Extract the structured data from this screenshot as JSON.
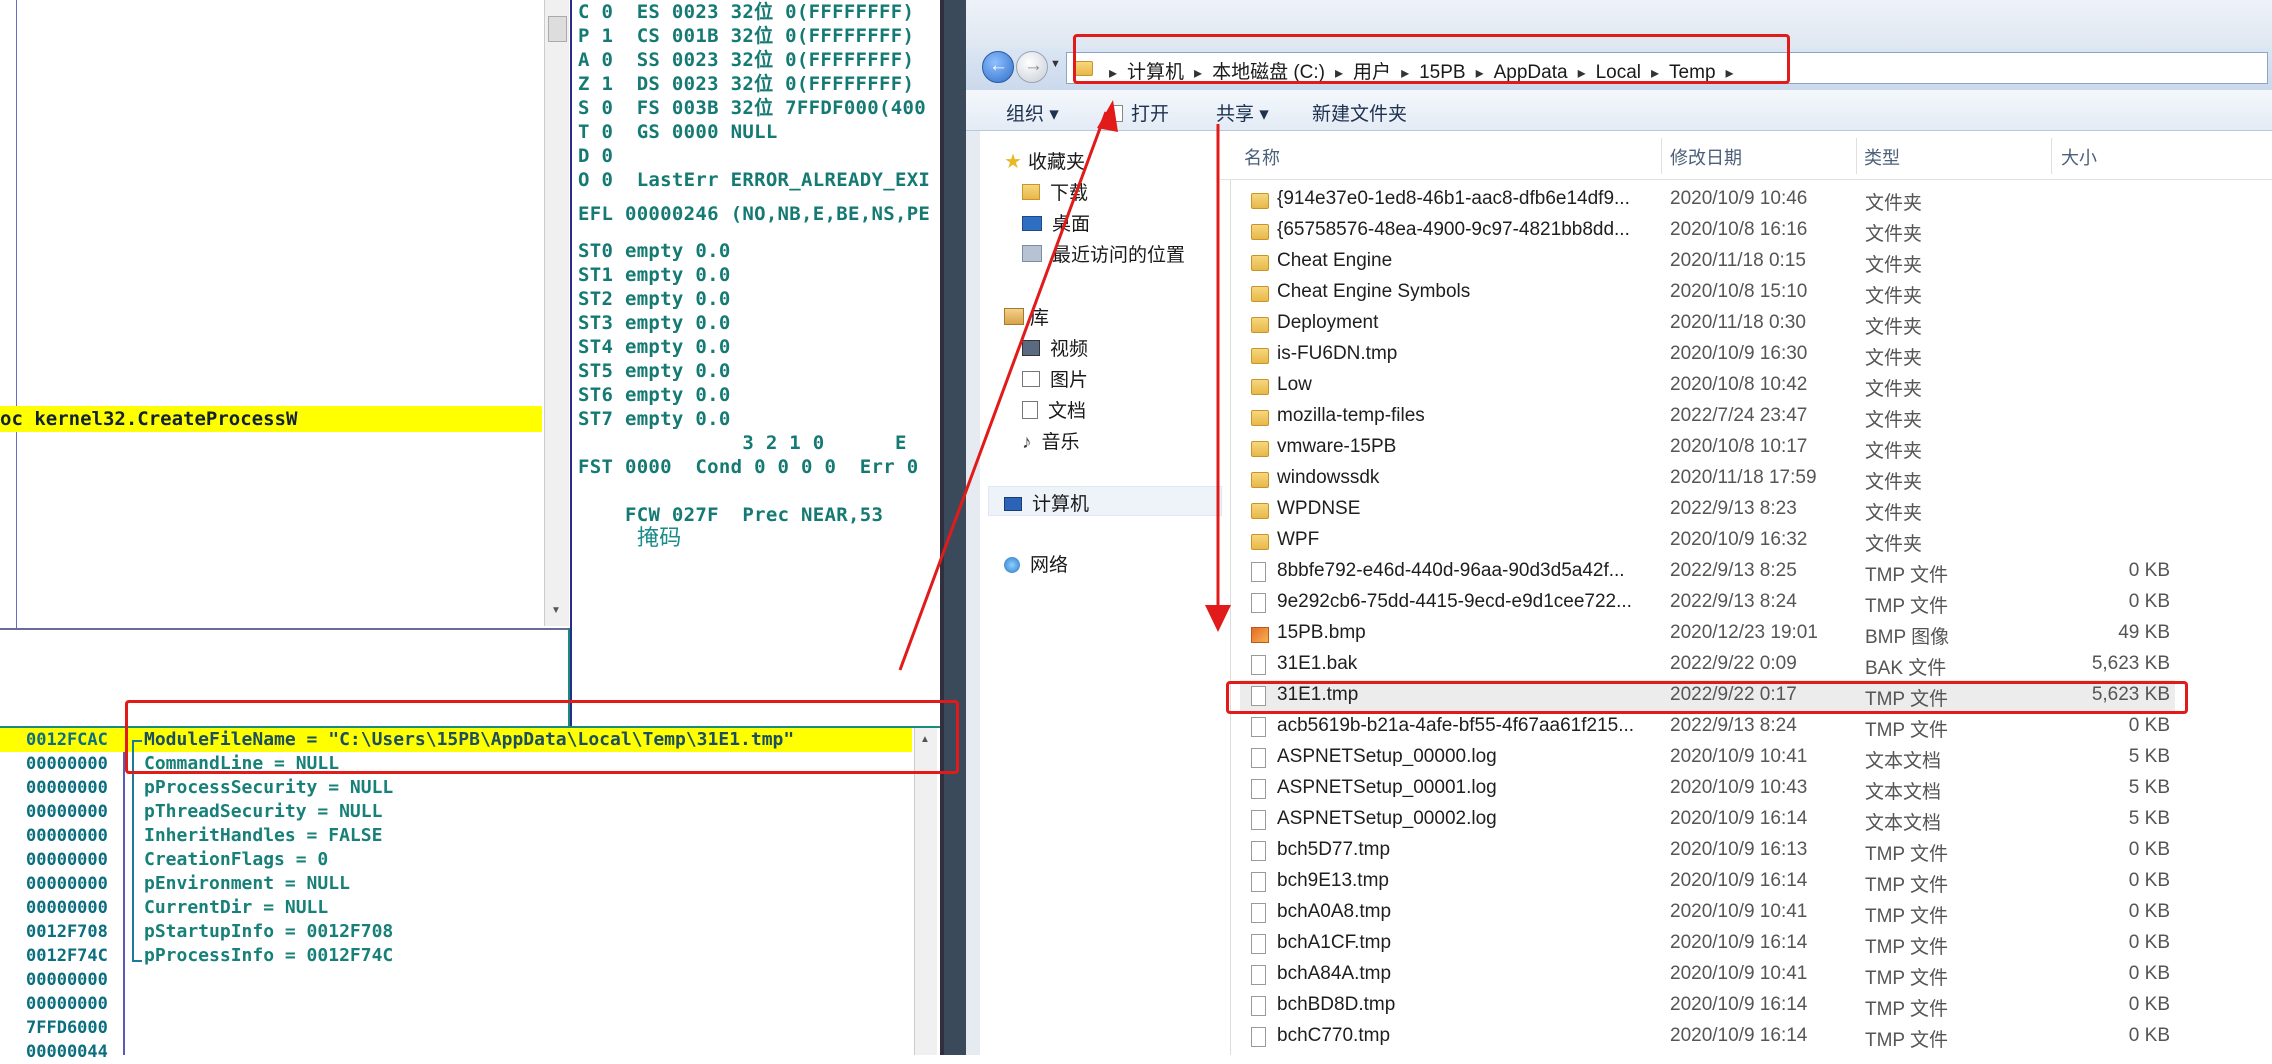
{
  "debugger": {
    "registers": [
      {
        "text": "C 0  ES 0023 32位 0(FFFFFFFF)"
      },
      {
        "text": "P 1  CS 001B 32位 0(FFFFFFFF)"
      },
      {
        "text": "A 0  SS 0023 32位 0(FFFFFFFF)"
      },
      {
        "text": "Z 1  DS 0023 32位 0(FFFFFFFF)"
      },
      {
        "text": "S 0  FS 003B 32位 7FFDF000(400"
      },
      {
        "text": "T 0  GS 0000 NULL"
      },
      {
        "text": "D 0"
      },
      {
        "text": "O 0  LastErr ERROR_ALREADY_EXI"
      }
    ],
    "efl": "EFL 00000246 (NO,NB,E,BE,NS,PE",
    "fpu": [
      "ST0 empty 0.0",
      "ST1 empty 0.0",
      "ST2 empty 0.0",
      "ST3 empty 0.0",
      "ST4 empty 0.0",
      "ST5 empty 0.0",
      "ST6 empty 0.0",
      "ST7 empty 0.0"
    ],
    "fpu_header": "              3 2 1 0      E",
    "fst": "FST 0000  Cond 0 0 0 0  Err 0",
    "fcw": "FCW 027F  Prec NEAR,53",
    "fcw_mask": "掩码",
    "call_line": "oc kernel32.CreateProcessW",
    "stack_addrs": [
      "0012FCAC",
      "00000000",
      "00000000",
      "00000000",
      "00000000",
      "00000000",
      "00000000",
      "00000000",
      "0012F708",
      "0012F74C",
      "00000000",
      "00000000",
      "7FFD6000",
      "00000044"
    ],
    "stack_desc": [
      "ModuleFileName = \"C:\\Users\\15PB\\AppData\\Local\\Temp\\31E1.tmp\"",
      "CommandLine = NULL",
      "pProcessSecurity = NULL",
      "pThreadSecurity = NULL",
      "InheritHandles = FALSE",
      "CreationFlags = 0",
      "pEnvironment = NULL",
      "CurrentDir = NULL",
      "pStartupInfo = 0012F708",
      "pProcessInfo = 0012F74C"
    ]
  },
  "explorer": {
    "breadcrumb": [
      "计算机",
      "本地磁盘 (C:)",
      "用户",
      "15PB",
      "AppData",
      "Local",
      "Temp"
    ],
    "toolbar": {
      "organize": "组织 ▾",
      "open": "打开",
      "share": "共享 ▾",
      "new_folder": "新建文件夹"
    },
    "sidebar": {
      "favorites": "收藏夹",
      "downloads": "下载",
      "desktop": "桌面",
      "recent": "最近访问的位置",
      "libraries": "库",
      "videos": "视频",
      "pictures": "图片",
      "documents": "文档",
      "music": "音乐",
      "computer": "计算机",
      "network": "网络"
    },
    "columns": {
      "name": "名称",
      "date": "修改日期",
      "type": "类型",
      "size": "大小"
    },
    "files": [
      {
        "name": "{914e37e0-1ed8-46b1-aac8-dfb6e14df9...",
        "date": "2020/10/9 10:46",
        "type": "文件夹",
        "size": "",
        "icon": "folder"
      },
      {
        "name": "{65758576-48ea-4900-9c97-4821bb8dd...",
        "date": "2020/10/8 16:16",
        "type": "文件夹",
        "size": "",
        "icon": "folder"
      },
      {
        "name": "Cheat Engine",
        "date": "2020/11/18 0:15",
        "type": "文件夹",
        "size": "",
        "icon": "folder"
      },
      {
        "name": "Cheat Engine Symbols",
        "date": "2020/10/8 15:10",
        "type": "文件夹",
        "size": "",
        "icon": "folder"
      },
      {
        "name": "Deployment",
        "date": "2020/11/18 0:30",
        "type": "文件夹",
        "size": "",
        "icon": "folder"
      },
      {
        "name": "is-FU6DN.tmp",
        "date": "2020/10/9 16:30",
        "type": "文件夹",
        "size": "",
        "icon": "folder"
      },
      {
        "name": "Low",
        "date": "2020/10/8 10:42",
        "type": "文件夹",
        "size": "",
        "icon": "folder"
      },
      {
        "name": "mozilla-temp-files",
        "date": "2022/7/24 23:47",
        "type": "文件夹",
        "size": "",
        "icon": "folder"
      },
      {
        "name": "vmware-15PB",
        "date": "2020/10/8 10:17",
        "type": "文件夹",
        "size": "",
        "icon": "folder"
      },
      {
        "name": "windowssdk",
        "date": "2020/11/18 17:59",
        "type": "文件夹",
        "size": "",
        "icon": "folder"
      },
      {
        "name": "WPDNSE",
        "date": "2022/9/13 8:23",
        "type": "文件夹",
        "size": "",
        "icon": "folder"
      },
      {
        "name": "WPF",
        "date": "2020/10/9 16:32",
        "type": "文件夹",
        "size": "",
        "icon": "folder"
      },
      {
        "name": "8bbfe792-e46d-440d-96aa-90d3d5a42f...",
        "date": "2022/9/13 8:25",
        "type": "TMP 文件",
        "size": "0 KB",
        "icon": "file"
      },
      {
        "name": "9e292cb6-75dd-4415-9ecd-e9d1cee722...",
        "date": "2022/9/13 8:24",
        "type": "TMP 文件",
        "size": "0 KB",
        "icon": "file"
      },
      {
        "name": "15PB.bmp",
        "date": "2020/12/23 19:01",
        "type": "BMP 图像",
        "size": "49 KB",
        "icon": "bmp"
      },
      {
        "name": "31E1.bak",
        "date": "2022/9/22 0:09",
        "type": "BAK 文件",
        "size": "5,623 KB",
        "icon": "file"
      },
      {
        "name": "31E1.tmp",
        "date": "2022/9/22 0:17",
        "type": "TMP 文件",
        "size": "5,623 KB",
        "icon": "file"
      },
      {
        "name": "acb5619b-b21a-4afe-bf55-4f67aa61f215...",
        "date": "2022/9/13 8:24",
        "type": "TMP 文件",
        "size": "0 KB",
        "icon": "file"
      },
      {
        "name": "ASPNETSetup_00000.log",
        "date": "2020/10/9 10:41",
        "type": "文本文档",
        "size": "5 KB",
        "icon": "file"
      },
      {
        "name": "ASPNETSetup_00001.log",
        "date": "2020/10/9 10:43",
        "type": "文本文档",
        "size": "5 KB",
        "icon": "file"
      },
      {
        "name": "ASPNETSetup_00002.log",
        "date": "2020/10/9 16:14",
        "type": "文本文档",
        "size": "5 KB",
        "icon": "file"
      },
      {
        "name": "bch5D77.tmp",
        "date": "2020/10/9 16:13",
        "type": "TMP 文件",
        "size": "0 KB",
        "icon": "file"
      },
      {
        "name": "bch9E13.tmp",
        "date": "2020/10/9 16:14",
        "type": "TMP 文件",
        "size": "0 KB",
        "icon": "file"
      },
      {
        "name": "bchA0A8.tmp",
        "date": "2020/10/9 10:41",
        "type": "TMP 文件",
        "size": "0 KB",
        "icon": "file"
      },
      {
        "name": "bchA1CF.tmp",
        "date": "2020/10/9 16:14",
        "type": "TMP 文件",
        "size": "0 KB",
        "icon": "file"
      },
      {
        "name": "bchA84A.tmp",
        "date": "2020/10/9 10:41",
        "type": "TMP 文件",
        "size": "0 KB",
        "icon": "file"
      },
      {
        "name": "bchBD8D.tmp",
        "date": "2020/10/9 16:14",
        "type": "TMP 文件",
        "size": "0 KB",
        "icon": "file"
      },
      {
        "name": "bchC770.tmp",
        "date": "2020/10/9 16:14",
        "type": "TMP 文件",
        "size": "0 KB",
        "icon": "file"
      }
    ]
  },
  "colors": {
    "annotation_red": "#e11a1a",
    "highlight_yellow": "#ffff00",
    "register_teal": "#157a73"
  }
}
